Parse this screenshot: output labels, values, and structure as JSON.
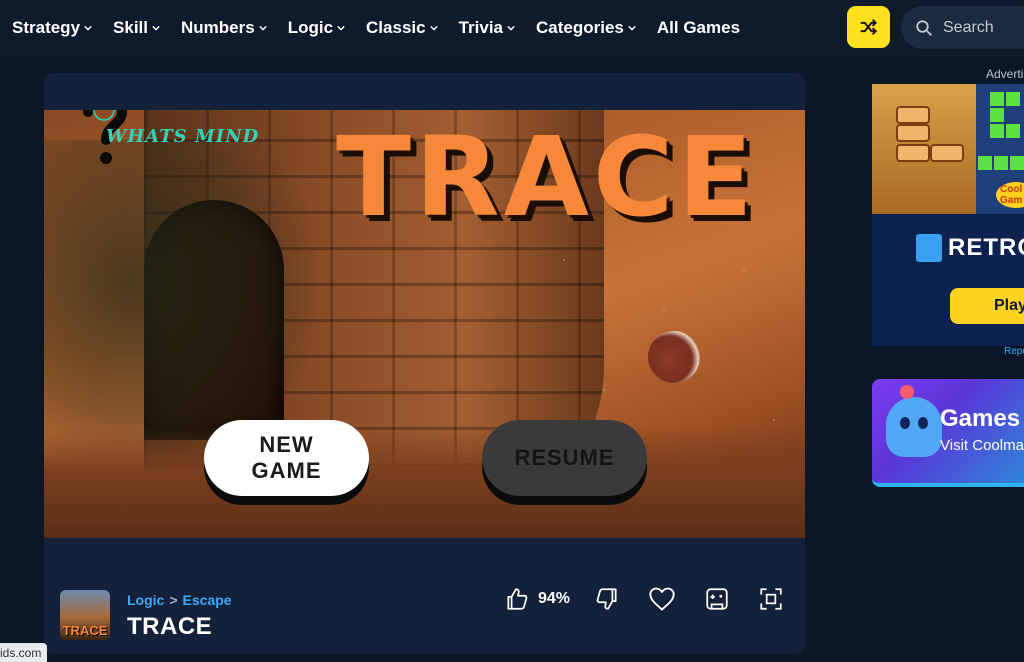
{
  "nav": {
    "items": [
      {
        "label": "Strategy",
        "dropdown": true
      },
      {
        "label": "Skill",
        "dropdown": true
      },
      {
        "label": "Numbers",
        "dropdown": true
      },
      {
        "label": "Logic",
        "dropdown": true
      },
      {
        "label": "Classic",
        "dropdown": true
      },
      {
        "label": "Trivia",
        "dropdown": true
      },
      {
        "label": "Categories",
        "dropdown": true
      },
      {
        "label": "All Games",
        "dropdown": false
      }
    ],
    "shuffle_icon": "shuffle-icon",
    "search_label": "Search"
  },
  "game": {
    "brand": "WHATS MIND",
    "title": "TRACE",
    "new_game_line1": "NEW",
    "new_game_line2": "GAME",
    "resume_label": "RESUME"
  },
  "footer": {
    "thumb_text": "TRACE",
    "category": "Logic",
    "separator": ">",
    "subcategory": "Escape",
    "title": "TRACE",
    "rating": "94%",
    "icons": [
      "thumbs-up-icon",
      "thumbs-down-icon",
      "heart-icon",
      "gamepad-icon",
      "fullscreen-icon"
    ]
  },
  "ads": {
    "label": "Advertisement",
    "ad1_brand": "Cool Gam",
    "ad1_title": "RETRO",
    "ad1_button": "Play",
    "report": "Report",
    "ad2_title": "Games",
    "ad2_sub": "Visit Coolma"
  },
  "status": {
    "url": "ids.com"
  },
  "colors": {
    "accent_yellow": "#ffe11e",
    "link_blue": "#3fa9f5",
    "title_orange": "#f7883a",
    "bg": "#0b1727"
  }
}
